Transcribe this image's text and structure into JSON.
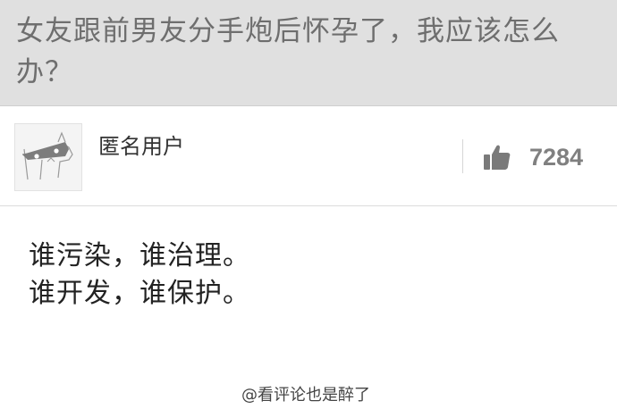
{
  "question": {
    "title": "女友跟前男友分手炮后怀孕了，我应该怎么办？"
  },
  "answer": {
    "author": "匿名用户",
    "vote_icon": "thumbs-up-icon",
    "vote_count": "7284",
    "lines": [
      "谁污染，谁治理。",
      "谁开发，谁保护。"
    ]
  },
  "watermark": {
    "text": "@看评论也是醉了"
  }
}
